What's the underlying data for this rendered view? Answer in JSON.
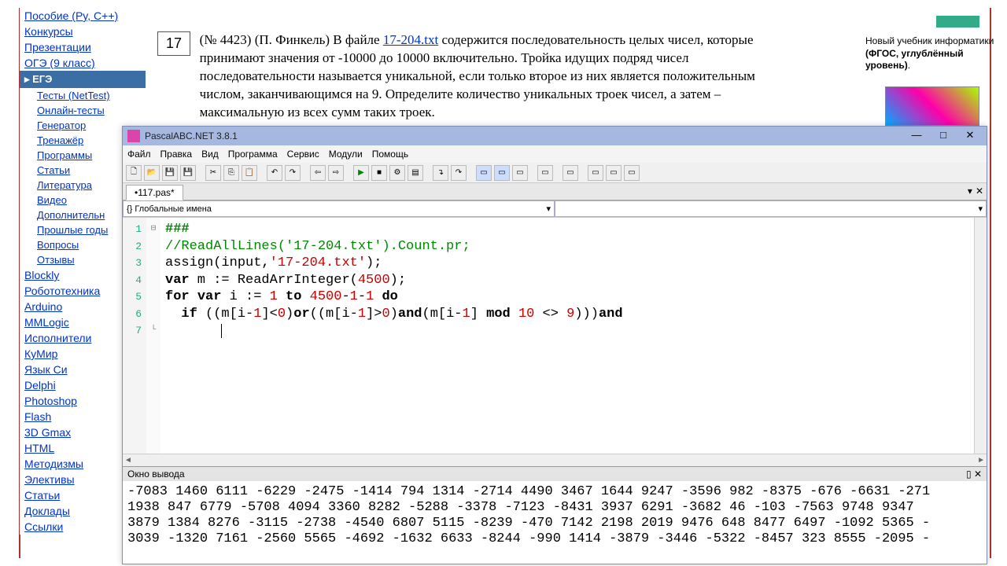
{
  "sidebar": {
    "items": [
      {
        "label": "Пособие (Py, C++)",
        "sub": false
      },
      {
        "label": "Конкурсы",
        "sub": false
      },
      {
        "label": "Презентации",
        "sub": false
      },
      {
        "label": "ОГЭ (9 класс)",
        "sub": false
      }
    ],
    "active": "ЕГЭ",
    "sub_items": [
      "Тесты (NetTest)",
      "Онлайн-тесты",
      "Генератор",
      "Тренажёр",
      "Программы",
      "Статьи",
      "Литература",
      "Видео",
      "Дополнительн",
      "Прошлые годы",
      "Вопросы",
      "Отзывы"
    ],
    "items2": [
      "Blockly",
      "Робототехника",
      "Arduino",
      "MMLogic",
      "Исполнители",
      "КуМир",
      "Язык Си",
      "Delphi",
      "Photoshop",
      "Flash",
      "3D Gmax",
      "HTML",
      "Методизмы",
      "Элективы",
      "Статьи",
      "Доклады",
      "Ссылки"
    ]
  },
  "task": {
    "number": "17",
    "prefix": "(№ 4423) (П. Финкель) В файле ",
    "link": "17-204.txt",
    "body": " содержится последовательность целых чисел, которые принимают значения от -10000 до 10000 включительно. Тройка идущих подряд чисел последовательности называется уникальной, если только второе из них является положительным числом, заканчивающимся на 9. Определите количество уникальных троек чисел, а затем – максимальную из всех сумм таких троек."
  },
  "rightinfo": {
    "line1": "Новый учебник информатики ",
    "bold": "(ФГОС, углублённый уровень)",
    "period": "."
  },
  "ide": {
    "title": "PascalABC.NET 3.8.1",
    "menu": [
      "Файл",
      "Правка",
      "Вид",
      "Программа",
      "Сервис",
      "Модули",
      "Помощь"
    ],
    "tab": "•117.pas*",
    "combo_left": "{} Глобальные имена",
    "code_lines": [
      {
        "n": "1",
        "fold": "⊟",
        "html": "<span class='dir'>###</span>"
      },
      {
        "n": "2",
        "fold": "",
        "html": "<span class='cmt'>//ReadAllLines('17-204.txt').Count.pr;</span>"
      },
      {
        "n": "3",
        "fold": "",
        "html": "assign(input,<span class='str'>'17-204.txt'</span>);"
      },
      {
        "n": "4",
        "fold": "",
        "html": "<span class='kw'>var</span> m := ReadArrInteger(<span class='num'>4500</span>);"
      },
      {
        "n": "5",
        "fold": "",
        "html": "<span class='kw'>for</span> <span class='kw'>var</span> i := <span class='num'>1</span> <span class='kw'>to</span> <span class='num'>4500</span>-<span class='num'>1</span>-<span class='num'>1</span> <span class='kw'>do</span>"
      },
      {
        "n": "6",
        "fold": "",
        "html": "  <span class='kw'>if</span> ((m[i-<span class='num'>1</span>]&lt;<span class='num'>0</span>)<span class='kw'>or</span>((m[i-<span class='num'>1</span>]&gt;<span class='num'>0</span>)<span class='kw'>and</span>(m[i-<span class='num'>1</span>] <span class='kw'>mod</span> <span class='num'>10</span> &lt;&gt; <span class='num'>9</span>)))<span class='kw'>and</span>"
      },
      {
        "n": "7",
        "fold": "└",
        "html": "       <span class='cursor'></span>"
      }
    ],
    "output_title": "Окно вывода",
    "output_lines": [
      "-7083 1460 6111 -6229 -2475 -1414 794 1314 -2714 4490 3467 1644 9247 -3596 982 -8375 -676 -6631 -271",
      "1938 847 6779 -5708 4094 3360 8282 -5288 -3378 -7123 -8431 3937 6291 -3682 46 -103 -7563 9748 9347 ",
      "3879 1384 8276 -3115 -2738 -4540 6807 5115 -8239 -470 7142 2198 2019 9476 648 8477 6497 -1092 5365 -",
      "3039 -1320 7161 -2560 5565 -4692 -1632 6633 -8244 -990 1414 -3879 -3446 -5322 -8457 323 8555 -2095 -"
    ]
  },
  "window_controls": {
    "min": "—",
    "max": "□",
    "close": "✕"
  },
  "chart_data": null
}
